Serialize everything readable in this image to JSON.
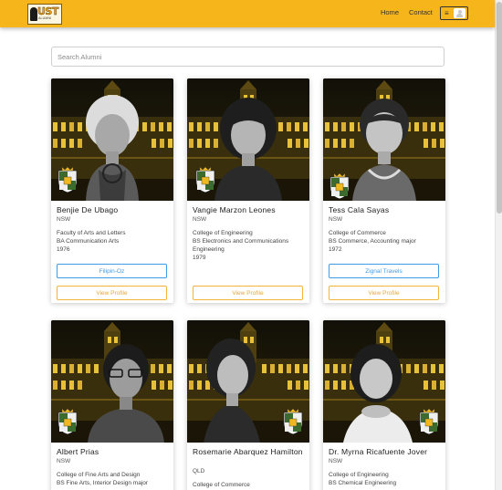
{
  "navbar": {
    "logo_text": "UST",
    "logo_subtext": "ALUMNI",
    "links": {
      "home": "Home",
      "contact": "Contact"
    },
    "toggle_icon": "≡",
    "colors": {
      "bar": "#f7b51c"
    }
  },
  "search": {
    "placeholder": "Search Alumni",
    "value": ""
  },
  "alumni": [
    {
      "name": "Benjie De Ubago",
      "state": "NSW",
      "faculty": "Faculty of Arts and Letters",
      "degree": "BA Communication Arts",
      "year": "1976",
      "company_button": "Filipin-Oz",
      "profile_button": "View Profile"
    },
    {
      "name": "Vangie Marzon Leones",
      "state": "NSW",
      "faculty": "College of Engineering",
      "degree": "BS Electronics and Communications Engineering",
      "year": "1979",
      "profile_button": "View Profile"
    },
    {
      "name": "Tess Cala Sayas",
      "state": "NSW",
      "faculty": "College of Commerce",
      "degree": "BS Commerce, Accounting major",
      "year": "1972",
      "company_button": "Zignal Travels",
      "profile_button": "View Profile"
    },
    {
      "name": "Albert Prias",
      "state": "NSW",
      "faculty": "College of Fine Arts and Design",
      "degree": "BS Fine Arts, Interior Design major"
    },
    {
      "name": "Rosemarie Abarquez Hamilton",
      "state": "QLD",
      "faculty": "College of Commerce"
    },
    {
      "name": "Dr. Myrna Ricafuente Jover",
      "state": "NSW",
      "faculty": "College of Engineering",
      "degree": "BS Chemical Engineering"
    }
  ],
  "colors": {
    "company_button": "#3e9be8",
    "profile_button": "#f2b43a",
    "scrollbar_thumb": "#c4c4c4"
  }
}
